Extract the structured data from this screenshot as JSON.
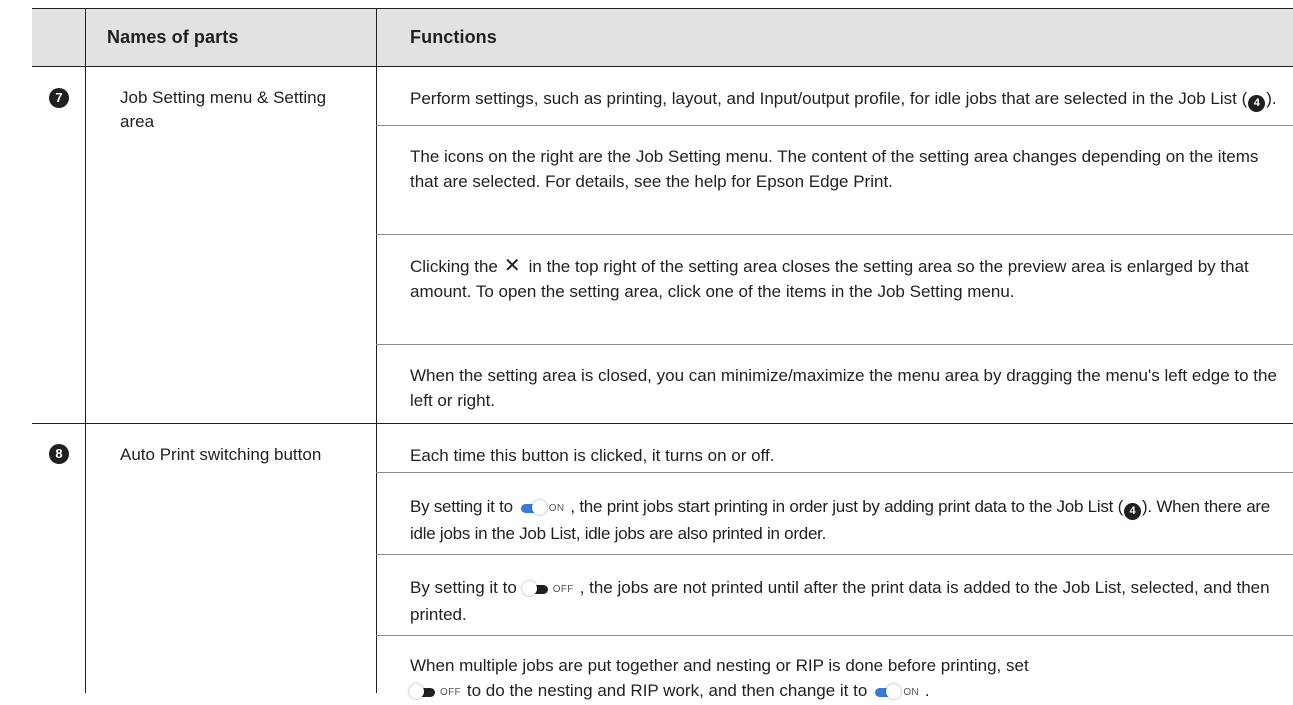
{
  "header": {
    "names_label": "Names of parts",
    "functions_label": "Functions"
  },
  "rows": [
    {
      "number": "7",
      "name": "Job Setting menu & Setting area",
      "p1_before": "Perform settings, such as printing, layout, and Input/output profile, for idle jobs that are selected in the Job List (",
      "p1_ref": "4",
      "p1_after": ").",
      "p2": "The icons on the right are the Job Setting menu. The content of the setting area changes depending on the items that are selected. For details, see the help for Epson Edge Print.",
      "p3_before": "Clicking the",
      "p3_icon": "close-icon",
      "p3_after": "in the top right of the setting area closes the setting area so the preview area is enlarged by that amount. To open the setting area, click one of the items in the Job Setting menu.",
      "p4": "When the setting area is closed, you can minimize/maximize the menu area by dragging the menu's left edge to the left or right."
    },
    {
      "number": "8",
      "name": "Auto Print switching button",
      "p1": "Each time this button is clicked, it turns on or off.",
      "p2_before": "By setting it to",
      "p2_middle": ", the print jobs start printing in order just by adding print data to the Job List (",
      "p2_ref": "4",
      "p2_after": "). When there are idle jobs in the Job List, idle jobs are also printed in order.",
      "p3_before": "By setting it to",
      "p3_after": ", the jobs are not printed until after the print data is added to the Job List, selected, and then printed.",
      "p4_line1": "When multiple jobs are put together and nesting or RIP is done before printing, set",
      "p4_mid": "to do the nesting and RIP work, and then change it to",
      "p4_end": "."
    }
  ],
  "toggles": {
    "on_label": "ON",
    "off_label": "OFF",
    "on_color": "#3a7bd5",
    "off_color": "#231f20"
  },
  "colors": {
    "header_bg": "#e2e2e2",
    "text": "#231f20",
    "separator": "#8c8c8c"
  }
}
